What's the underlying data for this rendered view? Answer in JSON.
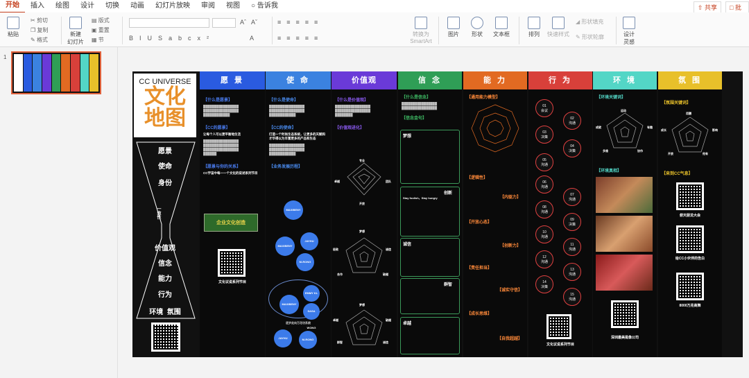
{
  "menu": {
    "items": [
      "开始",
      "插入",
      "绘图",
      "设计",
      "切换",
      "动画",
      "幻灯片放映",
      "审阅",
      "视图"
    ],
    "tell_me": "告诉我",
    "share": "共享",
    "comment": "批注"
  },
  "ribbon": {
    "paste": "粘贴",
    "cut": "剪切",
    "copy": "复制",
    "format": "格式",
    "new_slide": "新建\n幻灯片",
    "layout": "版式",
    "reset": "重置",
    "section": "节",
    "convert_smartart": "转换为\nSmartArt",
    "picture": "图片",
    "shape": "形状",
    "textbox": "文本框",
    "arrange": "排列",
    "quick_styles": "快速样式",
    "shape_fill": "形状填充",
    "shape_outline": "形状轮廓",
    "designer": "设计\n灵感"
  },
  "thumbnails": {
    "number": "1"
  },
  "slide": {
    "logo_en": "CC UNIVERSE",
    "logo_cn_1": "文化",
    "logo_cn_2": "地图",
    "nav": [
      "愿景",
      "使命",
      "身份",
      "价值观",
      "信念",
      "能力",
      "行为",
      "环境  氛围"
    ],
    "nav_side": "一致性",
    "qr1_label": "",
    "columns": {
      "vision": {
        "title": "愿 景",
        "color": "#2a5be0",
        "s1": "【什么是愿景】",
        "s2": "【CC的愿景】",
        "s2b": "让每个人可以更平衡地生活",
        "s3": "【愿景与你的关系】",
        "s3b": "CC宇宙中每一一个文化的说述系列节目",
        "qr_label": "文化议说系列节目",
        "banner": "企业文化创造"
      },
      "mission": {
        "title": "使 命",
        "color": "#3b82e0",
        "s1": "【什么是使命】",
        "s2": "【CC的使命】",
        "s2b": "打造一个时尚生态系统，让更多的天赋和才华得以为丰富更多的产品和生态",
        "s3": "【业务发展历程】",
        "circles": [
          "MAXIBENY",
          "MAXIBENY",
          "JAYHU",
          "M-RONG",
          "MAXIBENY",
          "SASA WONG",
          "EMMY KL",
          "JAYHU",
          "M-RONG"
        ],
        "cap": "逐步走向万花坊系统"
      },
      "values": {
        "title": "价值观",
        "color": "#6a3ad8",
        "s1": "【什么是价值观】",
        "s2": "【价值观进化】",
        "p1": [
          "专业",
          "卓越",
          "团队",
          "开放"
        ],
        "p2": [
          "梦想",
          "极致",
          "诚信",
          "合作",
          "破越"
        ],
        "p3": [
          "梦想",
          "卓越",
          "破越",
          "群智",
          "诚信"
        ]
      },
      "belief": {
        "title": "信 念",
        "color": "#2f9e56",
        "s1": "【什么是信念】",
        "s2": "【信念金句】",
        "h": [
          "梦想",
          "创新",
          "诚信",
          "群智",
          "卓越"
        ],
        "quote": "Stay foolish，Stay hungry"
      },
      "ability": {
        "title": "能 力",
        "color": "#e26a22",
        "s1": "【通用能力模型】",
        "s2": "【逻辑性】",
        "s3": "【内驱力】",
        "s4": "【开放心态】",
        "s5": "【创新力】",
        "s6": "【责任担当】",
        "s7": "【诚实守信】",
        "s8": "【成长思维】",
        "s9": "【自我超越】"
      },
      "behavior": {
        "title": "行 为",
        "color": "#d8403a",
        "steps": [
          "01\n会议",
          "02\n沟通",
          "03\n决策",
          "04\n决策",
          "05\n沟通",
          "06\n沟通",
          "07\n沟通",
          "08\n沟通",
          "09\n决策",
          "10\n沟通",
          "11\n沟通",
          "12\n沟通",
          "13\n沟通",
          "14\n决策",
          "15\n沟通"
        ],
        "qr_label": "文化议说系列节目"
      },
      "environment": {
        "title": "环 境",
        "color": "#53d6c6",
        "s1": "【环境关键词】",
        "s2": "【环境真相】",
        "p": [
          "运动",
          "成就",
          "有趣",
          "多维",
          "协作"
        ],
        "qr_label": "深圳最美是像公司"
      },
      "atmosphere": {
        "title": "氛 围",
        "color": "#e8c02a",
        "s1": "【氛围关键词】",
        "s2": "【来到CC气息】",
        "p": [
          "用膳",
          "成长",
          "影响",
          "开放",
          "他有"
        ],
        "qr_labels": [
          "俯天厨龙大会",
          "给CC小伙伴的告白",
          "8000万兆商舞"
        ]
      }
    }
  },
  "colors": {
    "accent": "#c43e1c",
    "slide_bg": "#111111"
  }
}
